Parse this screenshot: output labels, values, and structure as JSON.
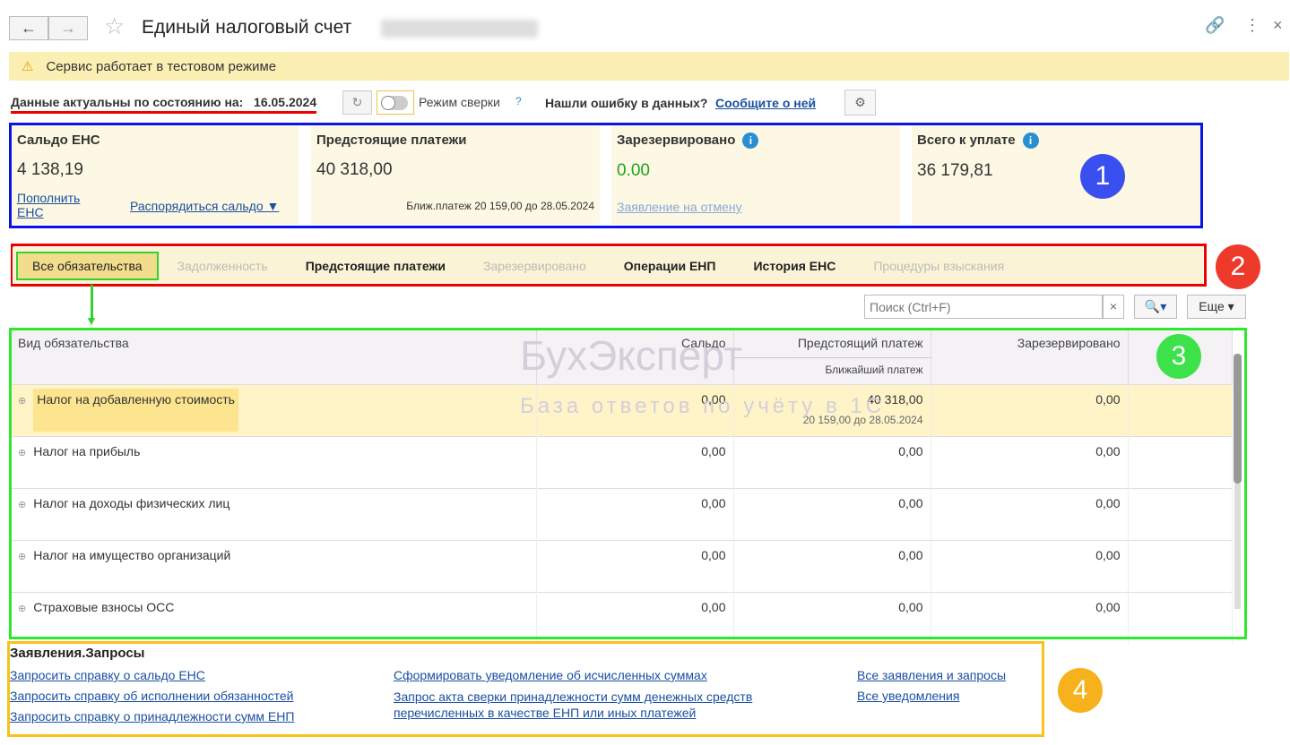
{
  "title": "Единый налоговый счет",
  "notice": "Сервис работает в тестовом режиме",
  "status": {
    "label": "Данные актуальны по состоянию на:",
    "date": "16.05.2024",
    "mode_label": "Режим сверки",
    "help": "?",
    "error_q": "Нашли ошибку в данных?",
    "error_link": "Сообщите о ней"
  },
  "cards": [
    {
      "title": "Сальдо ЕНС",
      "value": "4 138,19",
      "link1": "Пополнить ЕНС",
      "link2": "Распорядиться сальдо ▼"
    },
    {
      "title": "Предстоящие платежи",
      "value": "40 318,00",
      "note": "Ближ.платеж 20 159,00 до 28.05.2024"
    },
    {
      "title": "Зарезервировано",
      "value": "0.00",
      "link": "Заявление на отмену"
    },
    {
      "title": "Всего к уплате",
      "value": "36 179,81"
    }
  ],
  "badges": [
    "1",
    "2",
    "3",
    "4"
  ],
  "tabs": [
    "Все обязательства",
    "Задолженность",
    "Предстоящие платежи",
    "Зарезервировано",
    "Операции ЕНП",
    "История ЕНС",
    "Процедуры взыскания"
  ],
  "search": {
    "placeholder": "Поиск (Ctrl+F)",
    "more": "Еще"
  },
  "table": {
    "headers": [
      "Вид обязательства",
      "Сальдо",
      "Предстоящий платеж",
      "Ближайший платеж",
      "Зарезервировано"
    ],
    "rows": [
      {
        "name": "Налог на добавленную стоимость",
        "saldo": "0,00",
        "upcoming": "40 318,00",
        "nearest": "20 159,00 до 28.05.2024",
        "reserved": "0,00"
      },
      {
        "name": "Налог на прибыль",
        "saldo": "0,00",
        "upcoming": "0,00",
        "reserved": "0,00"
      },
      {
        "name": "Налог на доходы физических лиц",
        "saldo": "0,00",
        "upcoming": "0,00",
        "reserved": "0,00"
      },
      {
        "name": "Налог на имущество организаций",
        "saldo": "0,00",
        "upcoming": "0,00",
        "reserved": "0,00"
      },
      {
        "name": "Страховые взносы ОСС",
        "saldo": "0,00",
        "upcoming": "0,00",
        "reserved": "0,00"
      }
    ]
  },
  "watermark": {
    "brand": "БухЭксперт",
    "sub": "База ответов по учёту в 1С"
  },
  "requests": {
    "title": "Заявления.Запросы",
    "col1": [
      "Запросить справку о сальдо ЕНС",
      "Запросить справку об исполнении обязанностей",
      "Запросить справку о принадлежности сумм ЕНП"
    ],
    "col2": [
      "Сформировать уведомление об исчисленных суммах",
      "Запрос акта сверки принадлежности сумм денежных средств перечисленных в качестве ЕНП или иных платежей"
    ],
    "col3": [
      "Все заявления и запросы",
      "Все уведомления"
    ]
  }
}
